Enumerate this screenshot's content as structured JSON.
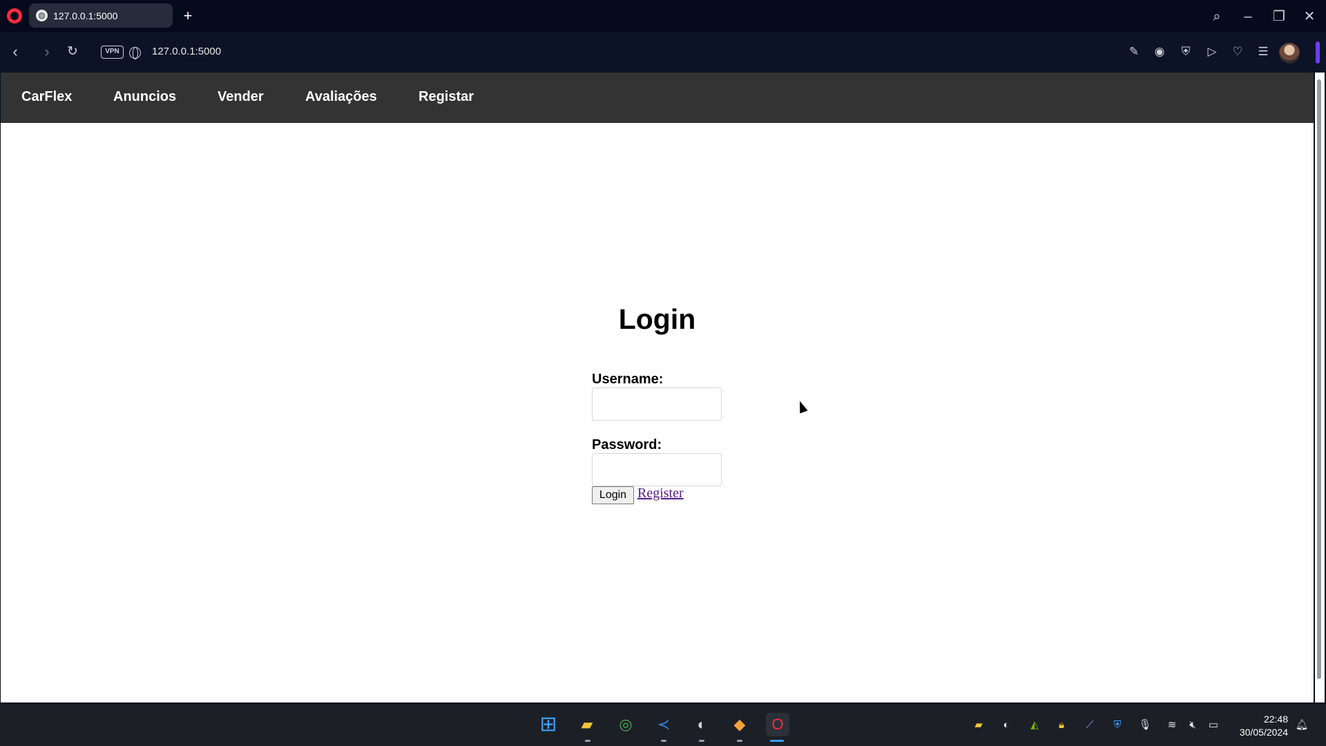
{
  "browser": {
    "tab_title": "127.0.0.1:5000",
    "url": "127.0.0.1:5000",
    "vpn_label": "VPN"
  },
  "site_nav": {
    "brand": "CarFlex",
    "items": [
      "Anuncios",
      "Vender",
      "Avaliações",
      "Registar"
    ]
  },
  "login_form": {
    "title": "Login",
    "username_label": "Username:",
    "username_value": "",
    "password_label": "Password:",
    "password_value": "",
    "submit_label": "Login",
    "register_link": "Register"
  },
  "taskbar": {
    "apps": [
      "windows-start",
      "file-explorer",
      "chrome",
      "vscode",
      "obs",
      "sublime-merge",
      "opera"
    ],
    "time": "22:48",
    "date": "30/05/2024"
  },
  "colors": {
    "nav_bg": "#333333",
    "link_visited": "#551a8b",
    "opera_red": "#ff2a3d",
    "sidebar_accent": "#6d3cff"
  }
}
